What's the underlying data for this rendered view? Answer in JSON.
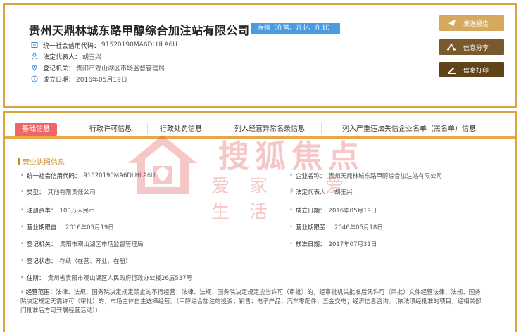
{
  "company": {
    "name": "贵州天鼎林城东路甲醇综合加注站有限公司",
    "status": "存续（在营、开业、在册）"
  },
  "summary": [
    {
      "icon": "credit-code-icon",
      "label": "统一社会信用代码：",
      "value": "91520190MA6DLHLA6U"
    },
    {
      "icon": "person-icon",
      "label": "法定代表人：",
      "value": "胡玉兴"
    },
    {
      "icon": "location-icon",
      "label": "登记机关：",
      "value": "贵阳市观山湖区市场监督管理局"
    },
    {
      "icon": "info-icon",
      "label": "成立日期：",
      "value": "2016年05月19日"
    }
  ],
  "actions": [
    {
      "icon": "send-icon",
      "label": "发送报告",
      "color": "#d5aa5e"
    },
    {
      "icon": "share-icon",
      "label": "信息分享",
      "color": "#7a5a2c"
    },
    {
      "icon": "print-icon",
      "label": "信息打印",
      "color": "#5f4319"
    }
  ],
  "tabs": [
    "基础信息",
    "行政许可信息",
    "行政处罚信息",
    "列入经营异常名录信息",
    "列入严重违法失信企业名单（黑名单）信息"
  ],
  "section_title": "营业执照信息",
  "fields_left": [
    {
      "label": "统一社会信用代码：",
      "value": "91520190MA6DLHLA6U"
    },
    {
      "label": "类型：",
      "value": "其他有限责任公司"
    },
    {
      "label": "注册资本：",
      "value": "100万人民币"
    },
    {
      "label": "营业期限自：",
      "value": "2016年05月19日"
    },
    {
      "label": "登记机关：",
      "value": "贵阳市观山湖区市场监督管理局"
    },
    {
      "label": "登记状态：",
      "value": "存续（在营、开业、在册）"
    },
    {
      "label": "住所：",
      "value": "贵州省贵阳市观山湖区人民政府行政办公楼26层537号"
    }
  ],
  "fields_right": [
    {
      "label": "企业名称：",
      "value": "贵州天鼎林城东路甲醇综合加注站有限公司"
    },
    {
      "label": "法定代表人：",
      "value": "胡玉兴"
    },
    {
      "label": "成立日期：",
      "value": "2016年05月19日"
    },
    {
      "label": "营业期限至：",
      "value": "2046年05月18日"
    },
    {
      "label": "核准日期：",
      "value": "2017年07月31日"
    }
  ],
  "scope": {
    "label": "经营范围：",
    "value": "法律、法规、国务院决定规定禁止的不得经营；法律、法规、国务院决定规定应当许可（审批）的，经审批机关批准后凭许可（审批）文件经营法律、法规、国务院决定规定无需许可（审批）的，市场主体自主选择经营。（甲醇综合加注站投资；销售：电子产品、汽车零配件、五金交电；经济信息咨询。（依法须经批准的项目，经相关部门批准后方可开展经营活动））"
  },
  "watermark": {
    "brand": "搜狐焦点",
    "slogan": "爱家，爱生活"
  },
  "colors": {
    "frame": "#d9a541",
    "status": "#4a9be0",
    "active_tab": "#f06666",
    "section": "#c98a28",
    "watermark": "#e23b3b"
  }
}
